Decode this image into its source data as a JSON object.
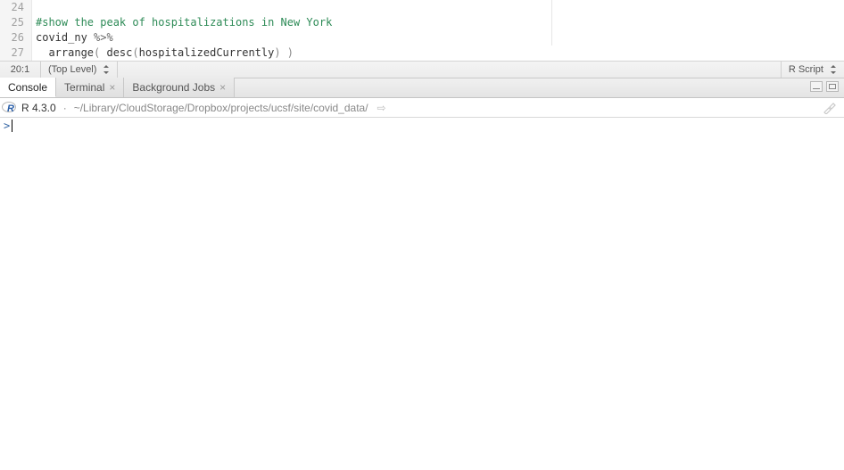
{
  "editor": {
    "lines": [
      {
        "num": "24",
        "tokens": []
      },
      {
        "num": "25",
        "tokens": [
          {
            "cls": "tok-comment",
            "text": "#show the peak of hospitalizations in New York"
          }
        ]
      },
      {
        "num": "26",
        "tokens": [
          {
            "cls": "tok-ident",
            "text": "covid_ny "
          },
          {
            "cls": "tok-op",
            "text": "%>%"
          }
        ]
      },
      {
        "num": "27",
        "tokens": [
          {
            "cls": "",
            "text": "  "
          },
          {
            "cls": "tok-fn",
            "text": "arrange"
          },
          {
            "cls": "tok-paren",
            "text": "( "
          },
          {
            "cls": "tok-fn",
            "text": "desc"
          },
          {
            "cls": "tok-paren",
            "text": "("
          },
          {
            "cls": "tok-ident",
            "text": "hospitalizedCurrently"
          },
          {
            "cls": "tok-paren",
            "text": ")"
          },
          {
            "cls": "tok-paren",
            "text": " )"
          }
        ]
      }
    ]
  },
  "statusbar": {
    "position": "20:1",
    "scope": "(Top Level)",
    "language": "R Script"
  },
  "tabs": {
    "items": [
      {
        "label": "Console",
        "closable": false,
        "active": true
      },
      {
        "label": "Terminal",
        "closable": true,
        "active": false
      },
      {
        "label": "Background Jobs",
        "closable": true,
        "active": false
      }
    ]
  },
  "console": {
    "version": "R 4.3.0",
    "separator": "·",
    "path": "~/Library/CloudStorage/Dropbox/projects/ucsf/site/covid_data/",
    "prompt": ">"
  }
}
